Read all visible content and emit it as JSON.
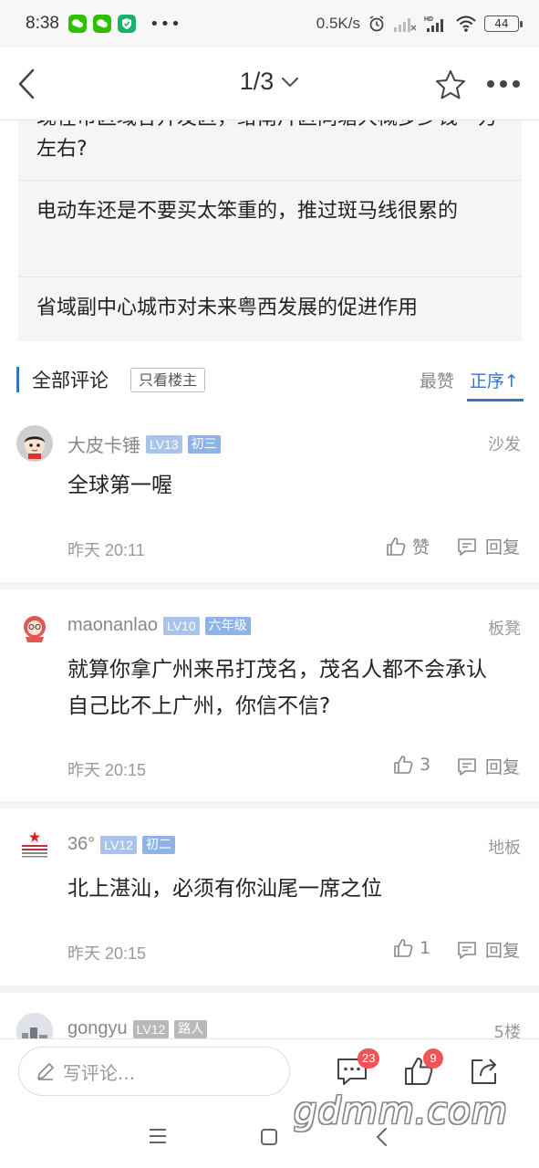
{
  "status_bar": {
    "time": "8:38",
    "net_speed": "0.5K/s",
    "battery": "44"
  },
  "nav": {
    "page_indicator": "1/3"
  },
  "related": {
    "items": [
      "现在市区域各开发区，给南片区同塘大概多少钱一方左右?",
      "电动车还是不要买太笨重的，推过斑马线很累的",
      "省域副中心城市对未来粤西发展的促进作用"
    ]
  },
  "comments_header": {
    "title": "全部评论",
    "owner_only": "只看楼主",
    "sort_hot": "最赞",
    "sort_order": "正序↑"
  },
  "comments": [
    {
      "name": "大皮卡锤",
      "level": "LV13",
      "grade": "初三",
      "floor": "沙发",
      "text": "全球第一喔",
      "time": "昨天 20:11",
      "likes": "赞",
      "reply": "回复"
    },
    {
      "name": "maonanlao",
      "level": "LV10",
      "grade": "六年级",
      "floor": "板凳",
      "text": "就算你拿广州来吊打茂名，茂名人都不会承认自己比不上广州，你信不信?",
      "time": "昨天 20:15",
      "likes": "3",
      "reply": "回复"
    },
    {
      "name": "36°",
      "level": "LV12",
      "grade": "初二",
      "floor": "地板",
      "text": "北上湛汕，必须有你汕尾一席之位",
      "time": "昨天 20:15",
      "likes": "1",
      "reply": "回复"
    },
    {
      "name": "gongyu",
      "level": "LV12",
      "grade": "路人",
      "floor": "5楼"
    }
  ],
  "bottom_bar": {
    "placeholder": "写评论...",
    "comment_count": "23",
    "like_count": "9"
  },
  "watermark": "gdmm.com",
  "colors": {
    "accent": "#3b73c6",
    "badge_red": "#f05454"
  }
}
